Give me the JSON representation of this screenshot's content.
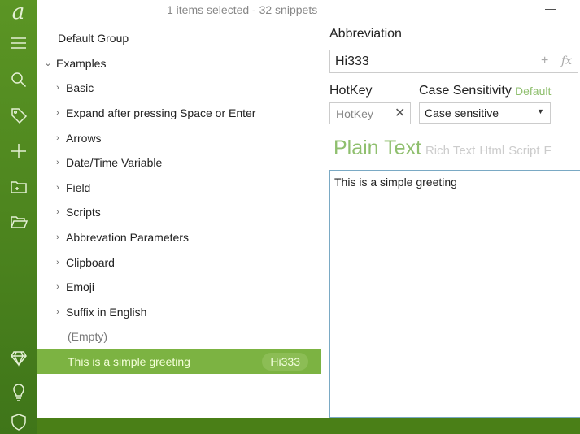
{
  "status": "1 items selected - 32 snippets",
  "sidebar": [
    "logo-icon",
    "menu-icon",
    "search-icon",
    "tag-icon",
    "add-icon",
    "new-folder-icon",
    "open-folder-icon",
    "diamond-icon",
    "lightbulb-icon",
    "shield-icon"
  ],
  "tree": {
    "default_group": "Default Group",
    "examples": "Examples",
    "children": [
      "Basic",
      "Expand after pressing Space or Enter",
      "Arrows",
      "Date/Time Variable",
      "Field",
      "Scripts",
      "Abbrevation Parameters",
      "Clipboard",
      "Emoji",
      "Suffix in English"
    ],
    "empty": "(Empty)",
    "selected": {
      "label": "This is a simple greeting",
      "abbr": "Hi333"
    }
  },
  "editor": {
    "abbreviation_label": "Abbreviation",
    "abbreviation_value": "Hi333",
    "plus": "+",
    "fx": "fx",
    "hotkey_label": "HotKey",
    "hotkey_placeholder": "HotKey",
    "clear": "✕",
    "case_label": "Case Sensitivity",
    "case_default": "Default",
    "case_value": "Case sensitive",
    "tabs": [
      "Plain Text",
      "Rich Text",
      "Html",
      "Script",
      "F"
    ],
    "content": "This is a simple greeting"
  },
  "colors": {
    "accent": "#7cb342",
    "sidebar": "#4f8a1f"
  }
}
